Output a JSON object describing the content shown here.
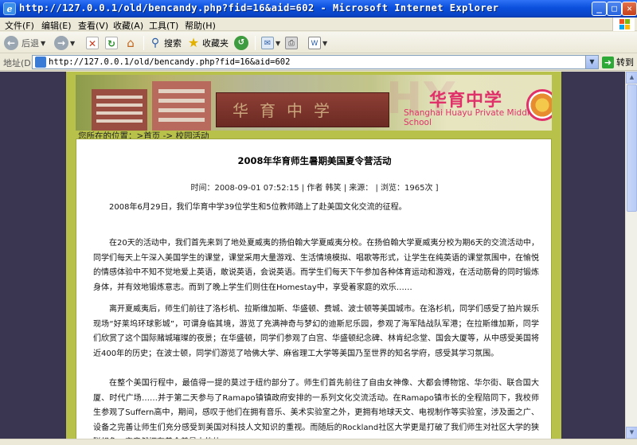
{
  "window": {
    "title": "http://127.0.0.1/old/bencandy.php?fid=16&aid=602 - Microsoft Internet Explorer",
    "minimize": "_",
    "maximize": "□",
    "close": "✕"
  },
  "menu": [
    "文件(F)",
    "编辑(E)",
    "查看(V)",
    "收藏(A)",
    "工具(T)",
    "帮助(H)"
  ],
  "toolbar": {
    "back_label": "后退",
    "search_label": "搜索",
    "favorites_label": "收藏夹"
  },
  "address": {
    "label": "地址(D)",
    "url": "http://127.0.0.1/old/bencandy.php?fid=16&aid=602",
    "go_label": "转到"
  },
  "banner": {
    "sign_text": "华育中学",
    "watermark": "HY",
    "school_name_cn": "华育中学",
    "school_name_en": "Shanghai Huayu Private Middle School"
  },
  "breadcrumb": "您所在的位置：>首页 -> 校园活动",
  "article": {
    "title": "2008年华育师生暑期美国夏令营活动",
    "meta": "时间：2008-09-01 07:52:15 | 作者 韩笑 | 来源： | 浏览：1965次 ]",
    "paragraphs": [
      "2008年6月29日，我们华育中学39位学生和5位教师踏上了赴美国文化交流的征程。",
      "在20天的活动中，我们首先来到了地处夏威夷的扬伯翰大学夏威夷分校。在扬伯翰大学夏威夷分校为期6天的交流活动中，同学们每天上午深入美国学生的课堂，课堂采用大量游戏、生活情境模拟、唱歌等形式，让学生在纯英语的课堂氛围中，在愉悦的情感体验中不知不觉地爱上英语，敢说英语，会说英语。而学生们每天下午参加各种体育运动和游戏，在活动筋骨的同时锻炼身体，并有效地锻炼意志。而到了晚上学生们则住在Homestay中，享受着家庭的欢乐……",
      "离开夏威夷后，师生们前往了洛杉机、拉斯维加斯、华盛顿、费城、波士顿等美国城市。在洛杉机，同学们感受了拍片娱乐现场“好莱坞环球影城”，可谓身临其境，游览了充满神奇与梦幻的迪斯尼乐园，参观了海军陆战队军港；在拉斯维加斯，同学们欣赏了这个国际赌城璀璨的夜景；在华盛顿，同学们参观了白宫、华盛顿纪念碑、林肯纪念堂、国会大厦等，从中感受美国将近400年的历史；在波士顿，同学们游览了哈佛大学、麻省理工大学等美国乃至世界的知名学府，感受其学习氛围。",
      "在整个美国行程中，最值得一提的莫过于纽约部分了。师生们首先前往了自由女神像、大都会博物馆、华尔街、联合国大厦、时代广场……并于第二天参与了Ramapo镇镇政府安排的一系列文化交流活动。在Ramapo镇市长的全程陪同下，我校师生参观了Suffern高中，期间，感叹于他们在拥有音乐、美术实验室之外，更拥有地球天文、电视制作等实验室，涉及面之广、设备之完善让师生们充分感受到美国对科技人文知识的重视。而随后的Rockland社区大学更是打破了我们师生对社区大学的狭隘想象，它竟然拥有着全美最大的体"
    ]
  }
}
